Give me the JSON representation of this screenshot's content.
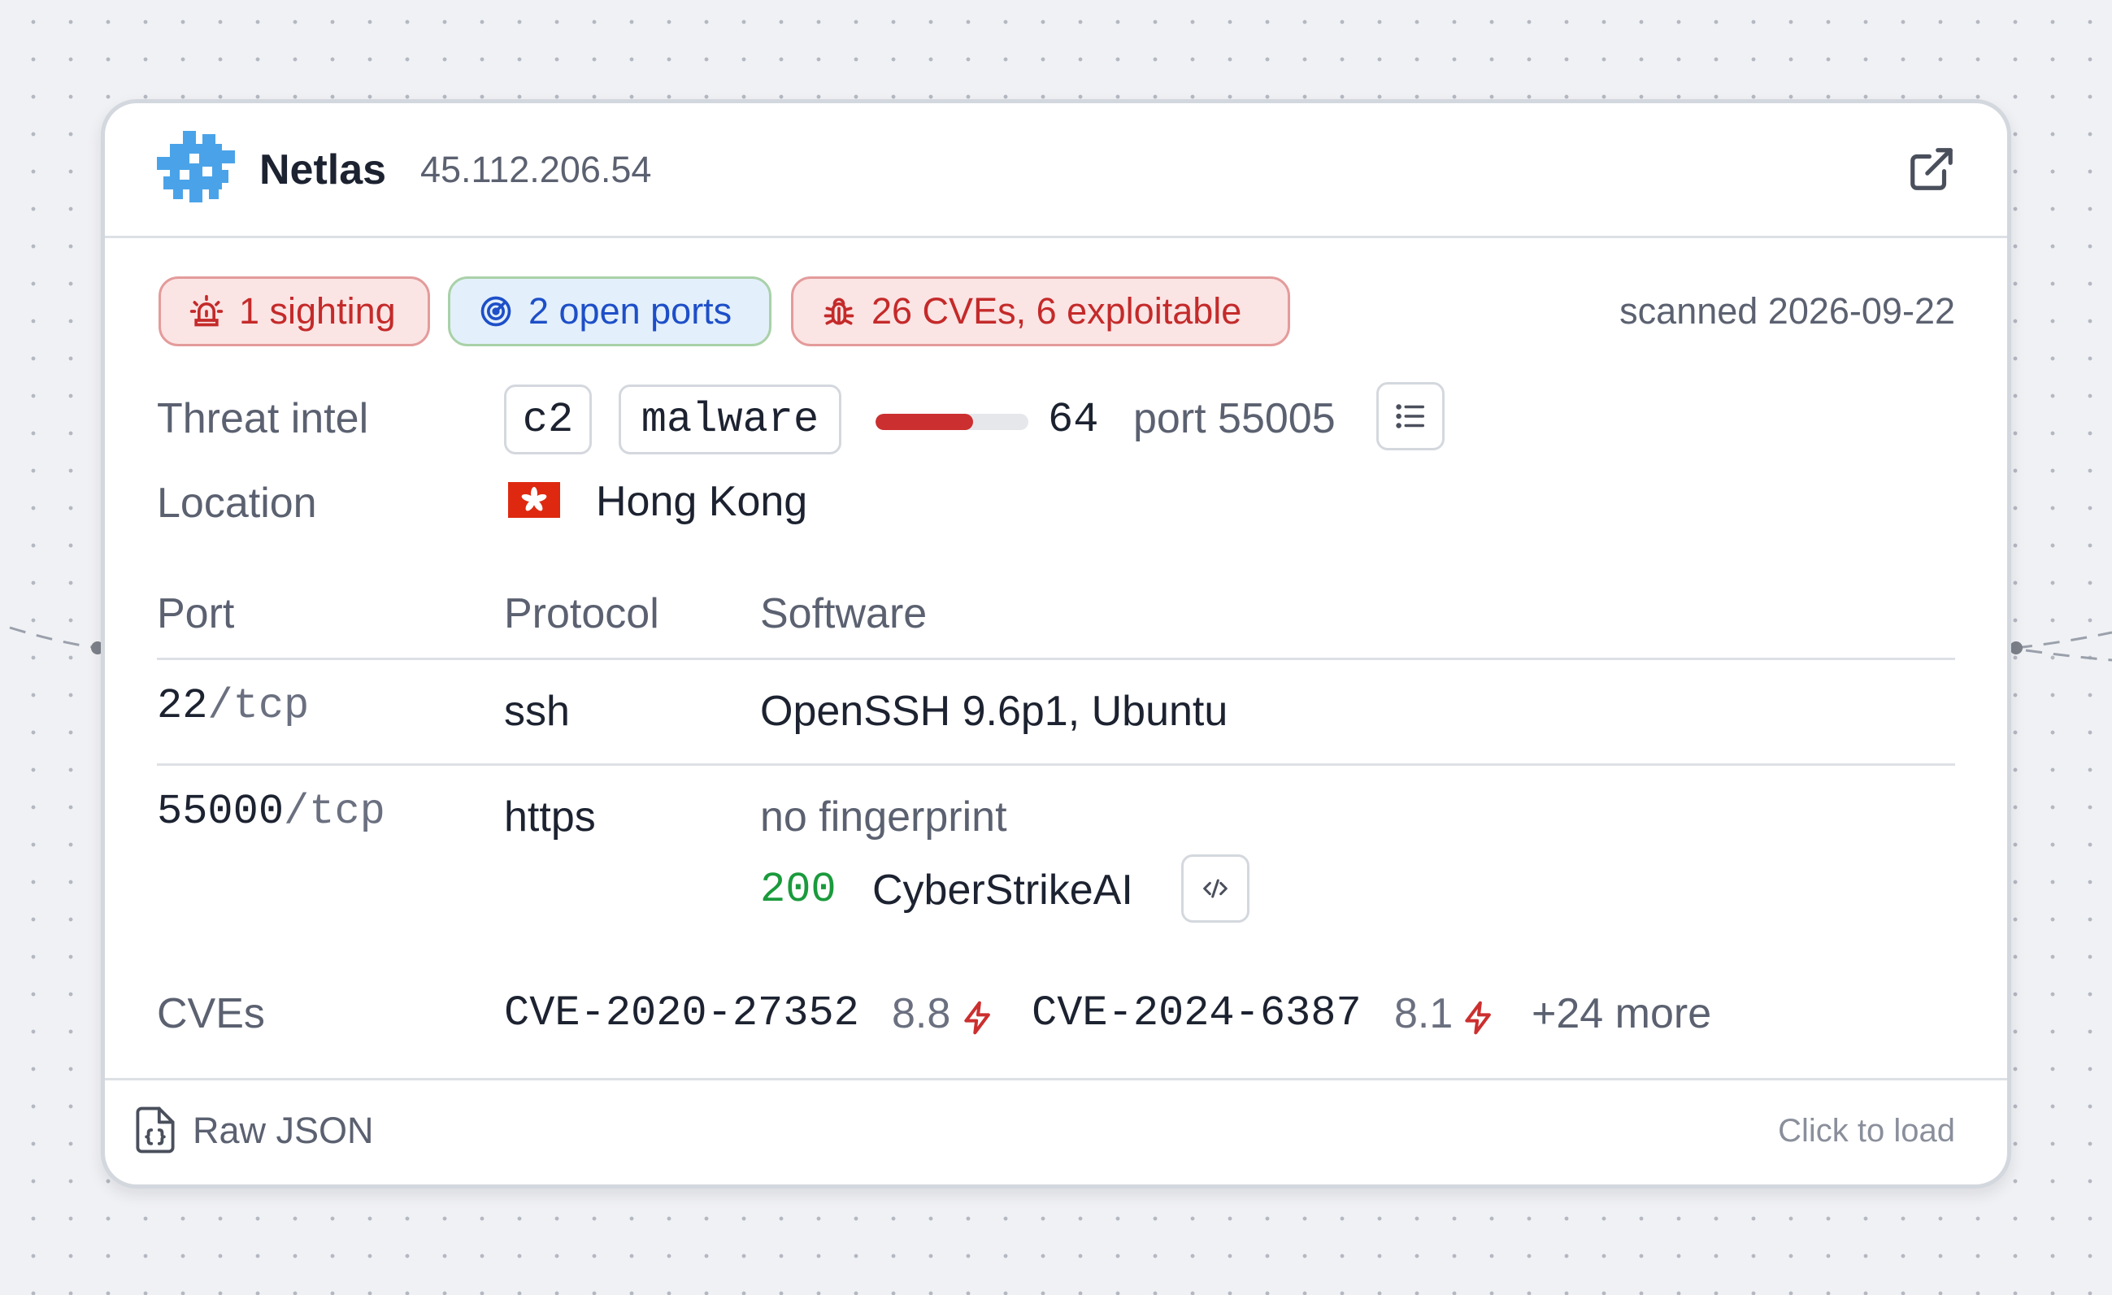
{
  "header": {
    "brand": "Netlas",
    "ip": "45.112.206.54"
  },
  "badges": {
    "sighting": "1 sighting",
    "open_ports": "2 open ports",
    "cves": "26 CVEs, 6 exploitable"
  },
  "scanned": "scanned 2026-09-22",
  "threat_intel": {
    "label": "Threat intel",
    "tags": [
      "c2",
      "malware"
    ],
    "score": "64",
    "score_fraction": 0.64,
    "port": "port 55005"
  },
  "location": {
    "label": "Location",
    "value": "Hong Kong"
  },
  "table": {
    "headers": {
      "port": "Port",
      "protocol": "Protocol",
      "software": "Software"
    },
    "rows": [
      {
        "port": "22",
        "transport": "/tcp",
        "protocol": "ssh",
        "software": "OpenSSH 9.6p1, Ubuntu"
      },
      {
        "port": "55000",
        "transport": "/tcp",
        "protocol": "https",
        "software": "no fingerprint",
        "http_status": "200",
        "http_title": "CyberStrikeAI"
      }
    ]
  },
  "cves": {
    "label": "CVEs",
    "items": [
      {
        "id": "CVE-2020-27352",
        "score": "8.8"
      },
      {
        "id": "CVE-2024-6387",
        "score": "8.1"
      }
    ],
    "more": "+24 more"
  },
  "footer": {
    "raw_json": "Raw JSON",
    "hint": "Click to load"
  },
  "colors": {
    "accent_red": "#cc2f2f",
    "accent_blue": "#1e4fc8",
    "status_green": "#1a9a3c",
    "brand_blue": "#4aa3e8"
  }
}
